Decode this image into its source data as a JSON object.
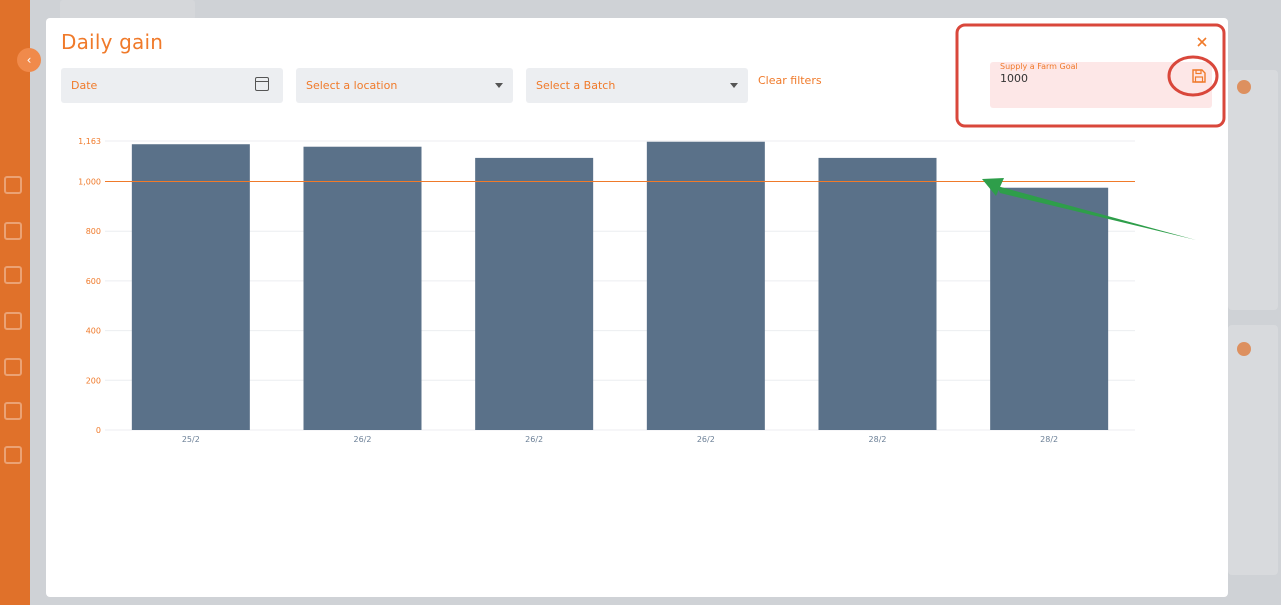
{
  "modal": {
    "title": "Daily gain",
    "filters": {
      "date_label": "Date",
      "location_placeholder": "Select a location",
      "batch_placeholder": "Select a Batch",
      "clear_label": "Clear filters"
    },
    "goal": {
      "label": "Supply a Farm Goal",
      "value": "1000"
    },
    "icons": {
      "date": "calendar-icon",
      "location": "chevron-down-icon",
      "batch": "chevron-down-icon",
      "save": "save-icon",
      "close": "close-icon"
    }
  },
  "colors": {
    "accent": "#f07a2a",
    "bar": "#5a7189",
    "goal_line": "#f07a2a",
    "annotation_red": "#d9473b",
    "annotation_green": "#2e9e4a"
  },
  "chart_data": {
    "type": "bar",
    "categories": [
      "25/2",
      "26/2",
      "26/2",
      "26/2",
      "28/2",
      "28/2"
    ],
    "values": [
      1150,
      1140,
      1095,
      1160,
      1095,
      975
    ],
    "y_ticks": [
      "0",
      "200",
      "400",
      "600",
      "800",
      "1,000",
      "1,163"
    ],
    "y_tick_values": [
      0,
      200,
      400,
      600,
      800,
      1000,
      1163
    ],
    "ylim": [
      0,
      1163
    ],
    "goal": 1000,
    "grid": true
  }
}
